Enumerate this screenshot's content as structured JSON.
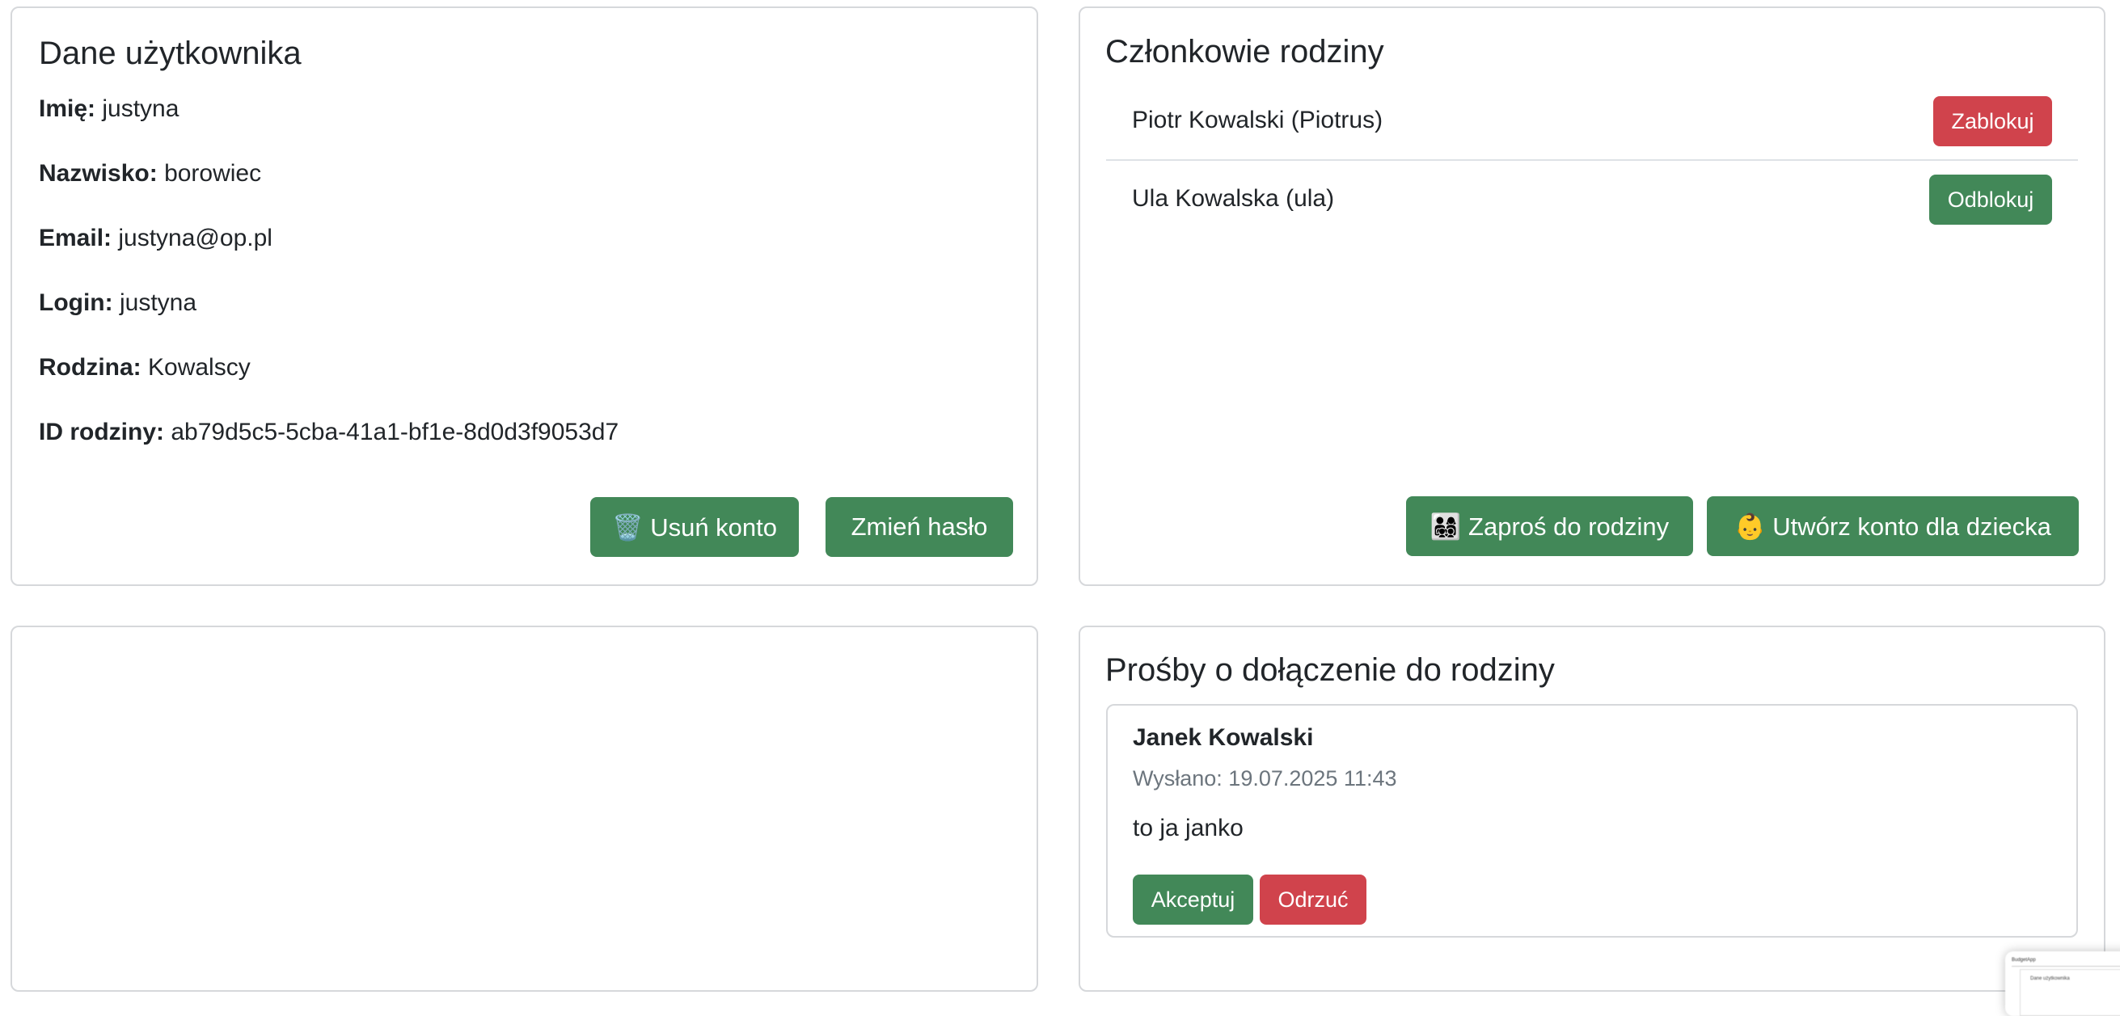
{
  "user_card": {
    "title": "Dane użytkownika",
    "fields": [
      {
        "label": "Imię:",
        "value": "justyna"
      },
      {
        "label": "Nazwisko:",
        "value": "borowiec"
      },
      {
        "label": "Email:",
        "value": "justyna@op.pl"
      },
      {
        "label": "Login:",
        "value": "justyna"
      },
      {
        "label": "Rodzina:",
        "value": "Kowalscy"
      },
      {
        "label": "ID rodziny:",
        "value": "ab79d5c5-5cba-41a1-bf1e-8d0d3f9053d7"
      }
    ],
    "delete_label": "🗑️ Usuń konto",
    "change_password_label": "Zmień hasło"
  },
  "family_card": {
    "title": "Członkowie rodziny",
    "members": [
      {
        "name": "Piotr Kowalski (Piotrus)",
        "action": "Zablokuj"
      },
      {
        "name": "Ula Kowalska (ula)",
        "action": "Odblokuj"
      }
    ],
    "invite_label": "👨‍👩‍👧‍👦 Zaproś do rodziny",
    "create_child_label": "👶 Utwórz konto dla dziecka"
  },
  "requests_card": {
    "title": "Prośby o dołączenie do rodziny",
    "requests": [
      {
        "name": "Janek Kowalski",
        "sent": "Wysłano: 19.07.2025 11:43",
        "message": "to ja janko",
        "accept": "Akceptuj",
        "reject": "Odrzuć"
      }
    ]
  },
  "colors": {
    "success": "#428858",
    "danger": "#d0434c",
    "border": "#d6d8db"
  },
  "thumbnail": {
    "app_name": "BudgetApp",
    "title": "Dane użytkownika"
  }
}
